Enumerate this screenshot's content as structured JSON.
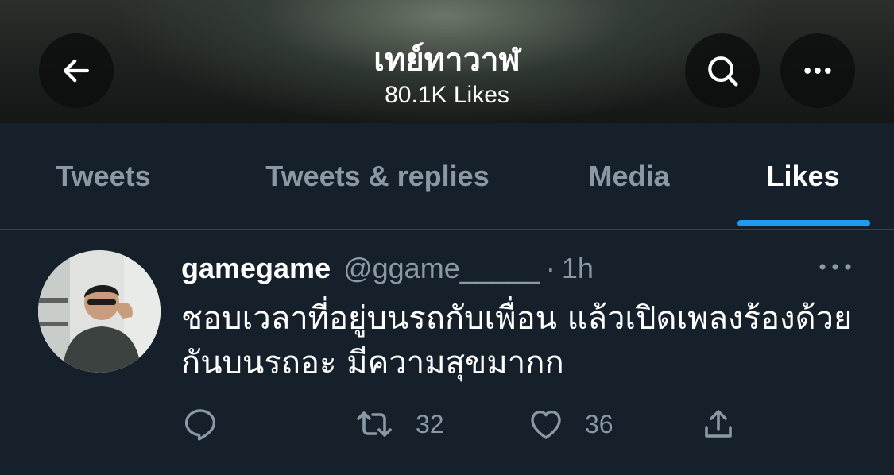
{
  "header": {
    "title": "เทย์ทาวาฬ",
    "subtitle": "80.1K Likes",
    "back_icon": "arrow-left-icon",
    "search_icon": "search-icon",
    "more_icon": "more-horizontal-icon"
  },
  "tabs": [
    {
      "label": "Tweets",
      "active": false
    },
    {
      "label": "Tweets & replies",
      "active": false
    },
    {
      "label": "Media",
      "active": false
    },
    {
      "label": "Likes",
      "active": true
    }
  ],
  "tweet": {
    "name": "gamegame",
    "handle": "@ggame_____",
    "separator": "·",
    "time": "1h",
    "text": "ชอบเวลาที่อยู่บนรถกับเพื่อน แล้วเปิดเพลงร้องด้วยกันบนรถอะ มีความสุขมากก",
    "actions": {
      "reply": {
        "icon": "reply-icon",
        "count": ""
      },
      "retweet": {
        "icon": "retweet-icon",
        "count": "32"
      },
      "like": {
        "icon": "heart-icon",
        "count": "36"
      },
      "share": {
        "icon": "share-icon",
        "count": ""
      }
    }
  },
  "colors": {
    "background": "#15202b",
    "accent": "#1d9bf0",
    "secondary_text": "#8b98a5",
    "divider": "#38444d"
  }
}
